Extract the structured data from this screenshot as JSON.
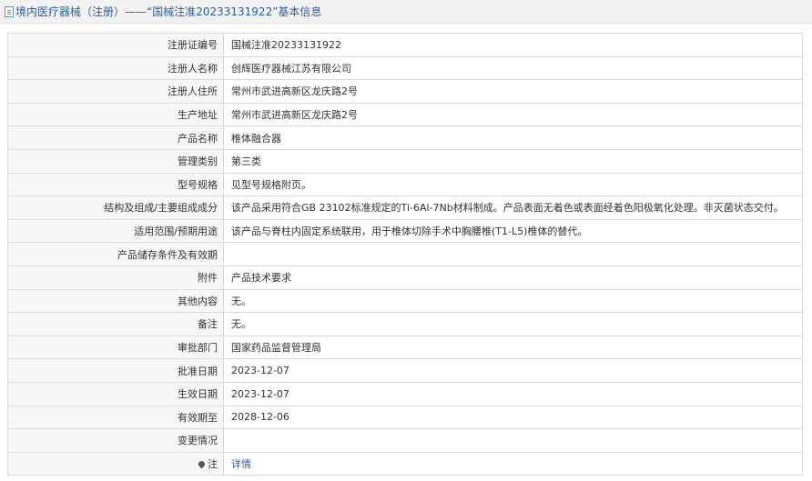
{
  "header": {
    "title": "境内医疗器械（注册）——“国械注准20233131922”基本信息"
  },
  "rows": [
    {
      "label": "注册证编号",
      "value": "国械注准20233131922"
    },
    {
      "label": "注册人名称",
      "value": "创辉医疗器械江苏有限公司"
    },
    {
      "label": "注册人住所",
      "value": "常州市武进高新区龙庆路2号"
    },
    {
      "label": "生产地址",
      "value": "常州市武进高新区龙庆路2号"
    },
    {
      "label": "产品名称",
      "value": "椎体融合器"
    },
    {
      "label": "管理类别",
      "value": "第三类"
    },
    {
      "label": "型号规格",
      "value": "见型号规格附页。"
    },
    {
      "label": "结构及组成/主要组成成分",
      "value": "该产品采用符合GB 23102标准规定的Ti-6Al-7Nb材料制成。产品表面无着色或表面经着色阳极氧化处理。非灭菌状态交付。"
    },
    {
      "label": "适用范围/预期用途",
      "value": "该产品与脊柱内固定系统联用，用于椎体切除手术中胸腰椎(T1-L5)椎体的替代。"
    },
    {
      "label": "产品储存条件及有效期",
      "value": ""
    },
    {
      "label": "附件",
      "value": "产品技术要求"
    },
    {
      "label": "其他内容",
      "value": "无。"
    },
    {
      "label": "备注",
      "value": "无。"
    },
    {
      "label": "审批部门",
      "value": "国家药品监督管理局"
    },
    {
      "label": "批准日期",
      "value": "2023-12-07"
    },
    {
      "label": "生效日期",
      "value": "2023-12-07"
    },
    {
      "label": "有效期至",
      "value": "2028-12-06"
    },
    {
      "label": "变更情况",
      "value": ""
    }
  ],
  "note": {
    "label": "注",
    "link": "详情"
  },
  "icons": {
    "header": "document-icon",
    "note": "map-pin-icon"
  },
  "colors": {
    "header_text": "#2a5d9c",
    "link": "#2a5d9c",
    "label_bg": "#f7f7f7",
    "border": "#d9d9d9"
  }
}
